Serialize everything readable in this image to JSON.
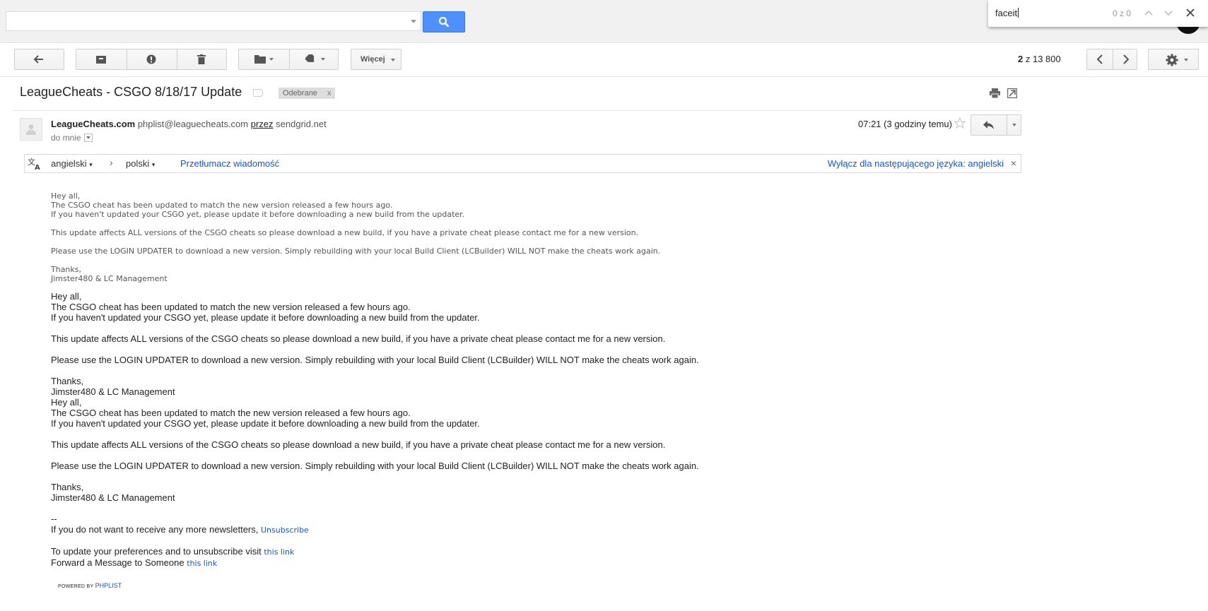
{
  "search": {
    "placeholder": "",
    "value": ""
  },
  "find_bar": {
    "query": "faceit",
    "count": "0 z 0"
  },
  "toolbar": {
    "more_label": "Więcej"
  },
  "pager": {
    "current": "2",
    "separator": " z ",
    "total": "13 800"
  },
  "message": {
    "subject": "LeagueCheats - CSGO 8/18/17 Update",
    "label": "Odebrane",
    "label_remove": "x",
    "sender_name": "LeagueCheats.com",
    "sender_email": "phplist@leaguecheats.com",
    "via_label": "przez",
    "via_domain": "sendgrid.net",
    "to": "do mnie",
    "time": "07:21 (3 godziny temu)"
  },
  "translate": {
    "source_lang": "angielski",
    "arrow": "›",
    "target_lang": "polski",
    "translate_link": "Przetłumacz wiadomość",
    "disable_link": "Wyłącz dla następującego języka: angielski",
    "close": "×"
  },
  "body": {
    "greeting": "Hey all,",
    "line1": "The CSGO cheat has been updated to match the new version released a few hours ago.",
    "line2": "If you haven't updated your CSGO yet, please update it before downloading a new build from the updater.",
    "line3": "This update affects ALL versions of the CSGO cheats so please download a new build, if you have a private cheat please contact me for a new version.",
    "line4": "Please use the LOGIN UPDATER to download a new version. Simply rebuilding with your local Build Client (LCBuilder) WILL NOT make the cheats work again.",
    "thanks": "Thanks,",
    "signature": "Jimster480 & LC Management",
    "sig_sep": "--",
    "unsub_text": "If you do not want to receive any more newsletters,",
    "unsub_link": "Unsubscribe",
    "prefs_text": "To update your preferences and to unsubscribe visit",
    "prefs_link": "this link",
    "forward_text": "Forward a Message to Someone",
    "forward_link": "this link",
    "powered_by": "POWERED BY",
    "powered_brand": "PHPLIST"
  },
  "colors": {
    "search_button": "#4d90fe",
    "link": "#1155cc"
  },
  "icons": [
    "search-icon",
    "back-icon",
    "archive-icon",
    "spam-icon",
    "trash-icon",
    "folder-icon",
    "label-icon",
    "chevron-left-icon",
    "chevron-right-icon",
    "gear-icon",
    "print-icon",
    "new-window-icon",
    "star-icon",
    "reply-icon",
    "translate-icon"
  ]
}
